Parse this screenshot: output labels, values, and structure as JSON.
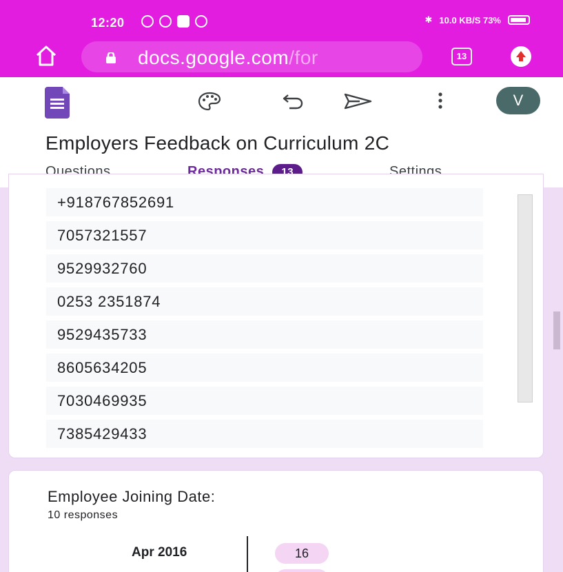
{
  "status_bar": {
    "time": "12:20",
    "right_text": "10.0 KB/S  73%",
    "icons": [
      "whatsapp-icon",
      "app-icon",
      "app-icon",
      "chrome-icon",
      "bluetooth-icon",
      "signal-icon",
      "battery-icon"
    ]
  },
  "browser": {
    "url_main": "docs.google.com",
    "url_fade": "/for",
    "tab_count": "13",
    "accent_color": "#e21de0"
  },
  "form": {
    "title": "Employers Feedback on Curriculum 2C",
    "avatar_letter": "V",
    "tabs": {
      "questions": "Questions",
      "responses": "Responses",
      "responses_count": "13",
      "settings": "Settings"
    }
  },
  "responses": [
    "+918767852691",
    "7057321557",
    "9529932760",
    "0253 2351874",
    "9529435733",
    "8605634205",
    "7030469935",
    "7385429433"
  ],
  "question2": {
    "title": "Employee Joining Date:",
    "count": "10 responses",
    "date_label": "Apr 2016",
    "date_value": "16"
  }
}
